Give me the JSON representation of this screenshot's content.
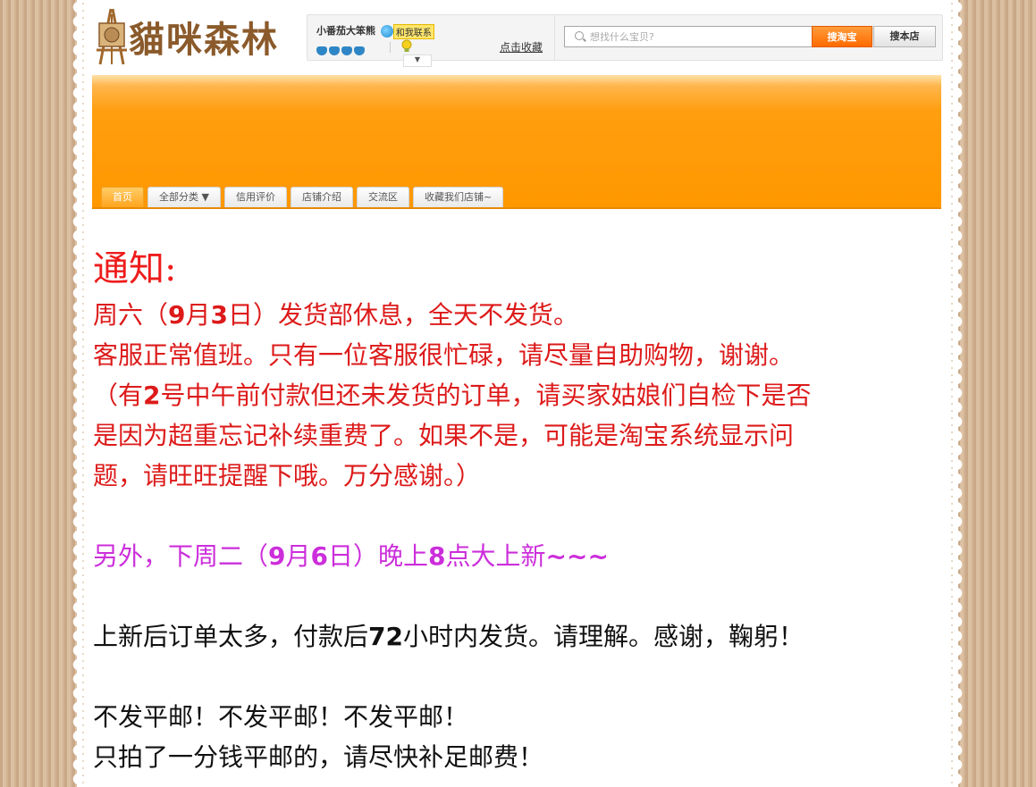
{
  "header": {
    "logo_text": "貓咪森林",
    "seller_name": "小番茄大笨熊",
    "contact_label": "和我联系",
    "favorite_link": "点击收藏",
    "search_placeholder": "想找什么宝贝?",
    "search_taobao_label": "搜淘宝",
    "search_store_label": "搜本店"
  },
  "nav": {
    "tabs": [
      {
        "label": "首页",
        "active": true
      },
      {
        "label": "全部分类 ▼",
        "active": false
      },
      {
        "label": "信用评价",
        "active": false
      },
      {
        "label": "店铺介绍",
        "active": false
      },
      {
        "label": "交流区",
        "active": false
      },
      {
        "label": "收藏我们店铺~",
        "active": false
      }
    ]
  },
  "notice": {
    "title": "通知:",
    "line1_a": "周六（",
    "line1_b": "9",
    "line1_c": "月",
    "line1_d": "3",
    "line1_e": "日）发货部休息，全天不发货。",
    "line2": "客服正常值班。只有一位客服很忙碌，请尽量自助购物，谢谢。",
    "line3_a": "（有",
    "line3_b": "2",
    "line3_c": "号中午前付款但还未发货的订单，请买家姑娘们自检下是否",
    "line4": "是因为超重忘记补续重费了。如果不是，可能是淘宝系统显示问",
    "line5": "题，请旺旺提醒下哦。万分感谢。）",
    "mag_a": "另外，下周二（",
    "mag_b": "9",
    "mag_c": "月",
    "mag_d": "6",
    "mag_e": "日）晚上",
    "mag_f": "8",
    "mag_g": "点大上新",
    "mag_h": "~~~",
    "black1_a": "上新后订单太多，付款后",
    "black1_b": "72",
    "black1_c": "小时内发货。请理解。感谢，鞠躬！",
    "black2": "不发平邮！不发平邮！不发平邮！",
    "black3": "只拍了一分钱平邮的，请尽快补足邮费！"
  },
  "colors": {
    "banner_orange": "#ff9800",
    "notice_red": "#dd1a1a",
    "notice_magenta": "#cc2edb",
    "search_button": "#ff6a00"
  }
}
